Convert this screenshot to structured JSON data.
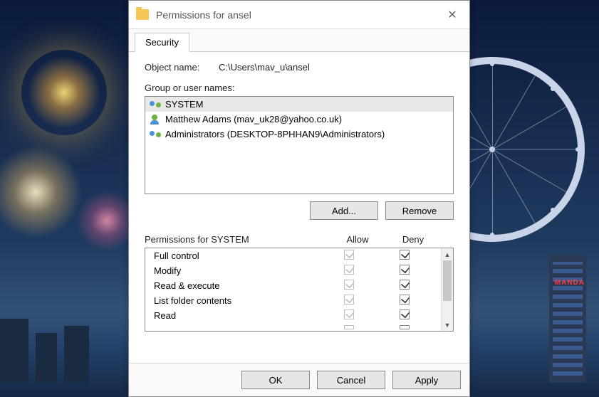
{
  "dialog": {
    "title": "Permissions for ansel",
    "tab": "Security",
    "object_label": "Object name:",
    "object_path": "C:\\Users\\mav_u\\ansel",
    "groups_label": "Group or user names:",
    "principals": [
      {
        "name": "SYSTEM",
        "kind": "sys",
        "selected": true
      },
      {
        "name": "Matthew Adams (mav_uk28@yahoo.co.uk)",
        "kind": "single",
        "selected": false
      },
      {
        "name": "Administrators (DESKTOP-8PHHAN9\\Administrators)",
        "kind": "grp",
        "selected": false
      }
    ],
    "add_button": "Add...",
    "remove_button": "Remove",
    "perm_for_label": "Permissions for SYSTEM",
    "col_allow": "Allow",
    "col_deny": "Deny",
    "permissions": [
      {
        "name": "Full control",
        "allow": true,
        "allow_enabled": false,
        "deny": true,
        "deny_enabled": true
      },
      {
        "name": "Modify",
        "allow": true,
        "allow_enabled": false,
        "deny": true,
        "deny_enabled": true
      },
      {
        "name": "Read & execute",
        "allow": true,
        "allow_enabled": false,
        "deny": true,
        "deny_enabled": true
      },
      {
        "name": "List folder contents",
        "allow": true,
        "allow_enabled": false,
        "deny": true,
        "deny_enabled": true
      },
      {
        "name": "Read",
        "allow": true,
        "allow_enabled": false,
        "deny": true,
        "deny_enabled": true
      }
    ],
    "ok": "OK",
    "cancel": "Cancel",
    "apply": "Apply"
  },
  "bg": {
    "sign": "MANDA"
  }
}
